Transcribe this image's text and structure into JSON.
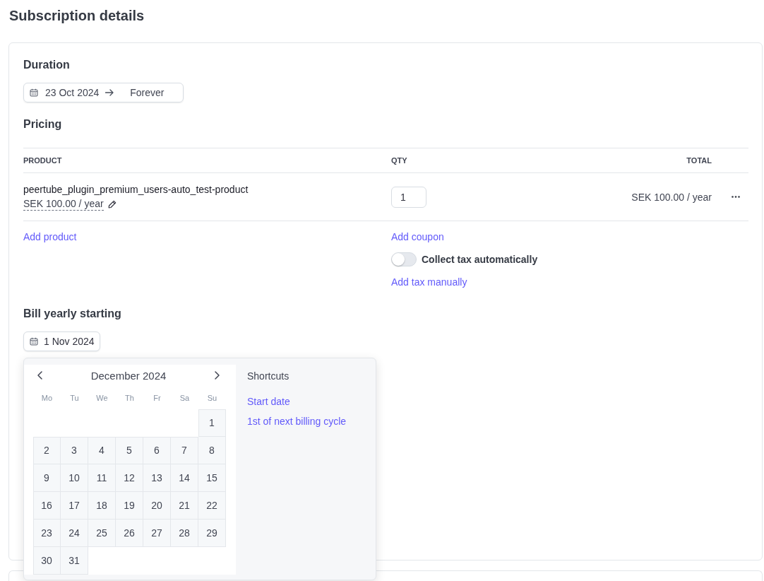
{
  "page": {
    "title": "Subscription details"
  },
  "duration": {
    "heading": "Duration",
    "start": "23 Oct 2024",
    "end": "Forever"
  },
  "pricing": {
    "heading": "Pricing",
    "columns": [
      "PRODUCT",
      "QTY",
      "TOTAL"
    ],
    "rows": [
      {
        "product": "peertube_plugin_premium_users-auto_test-product",
        "price": "SEK 100.00 / year",
        "qty": "1",
        "total": "SEK 100.00 / year"
      }
    ],
    "add_product": "Add product",
    "add_coupon": "Add coupon",
    "tax_toggle": {
      "label": "Collect tax automatically",
      "on": false
    },
    "add_tax": "Add tax manually"
  },
  "billing": {
    "heading": "Bill yearly starting",
    "date": "1 Nov 2024"
  },
  "date_picker": {
    "month": "December 2024",
    "weekdays": [
      "Mo",
      "Tu",
      "We",
      "Th",
      "Fr",
      "Sa",
      "Su"
    ],
    "weeks": [
      [
        "1"
      ],
      [
        "2",
        "3",
        "4",
        "5",
        "6",
        "7",
        "8"
      ],
      [
        "9",
        "10",
        "11",
        "12",
        "13",
        "14",
        "15"
      ],
      [
        "16",
        "17",
        "18",
        "19",
        "20",
        "21",
        "22"
      ],
      [
        "23",
        "24",
        "25",
        "26",
        "27",
        "28",
        "29"
      ],
      [
        "30",
        "31"
      ]
    ]
  },
  "shortcuts": {
    "heading": "Shortcuts",
    "items": [
      "Start date",
      "1st of next billing cycle"
    ]
  }
}
